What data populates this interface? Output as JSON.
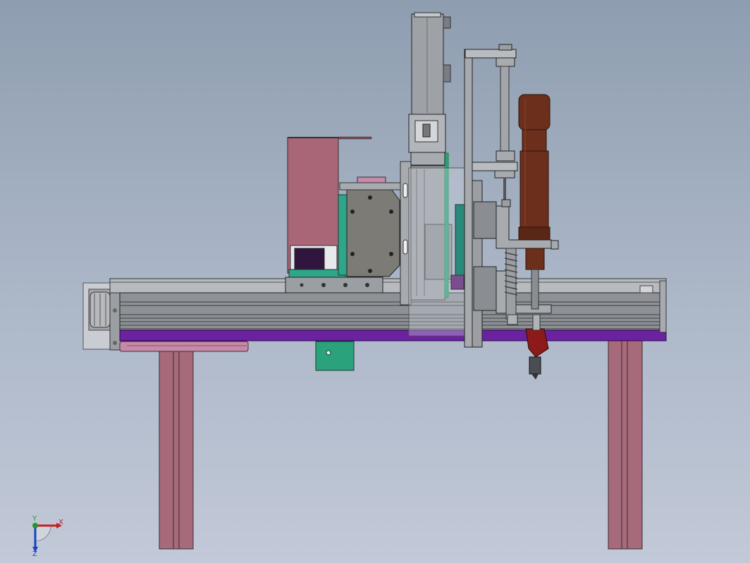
{
  "app": {
    "view": "front-view",
    "model": "gantry-screw-driving-assembly"
  },
  "colors": {
    "background_top": "#8e9db0",
    "background_bottom": "#c2c9d8",
    "aluminum": "#9b9fa3",
    "aluminum_dark": "#6c7074",
    "leg_pink": "#a66a7a",
    "motor_pink": "#c58aa8",
    "base_purple": "#6a22a0",
    "teal": "#2fa58a",
    "green_bracket": "#2aa37c",
    "cover_pink": "#a86677",
    "gray_plate": "#7c7b76",
    "driver_brown": "#6b2f1c",
    "red_nozzle": "#8c1a1a",
    "axis_x": "#c8201e",
    "axis_y": "#1e9a2c",
    "axis_z": "#1c3fc8"
  },
  "triad": {
    "x_label": "X",
    "y_label": "Y",
    "z_label": "Z"
  }
}
